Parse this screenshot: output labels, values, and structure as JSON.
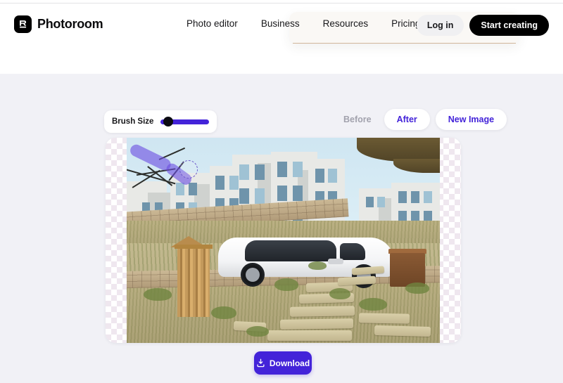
{
  "header": {
    "brand": {
      "name": "Photoroom",
      "logo_icon": "photoroom-logo-icon"
    },
    "nav": [
      {
        "label": "Photo editor"
      },
      {
        "label": "Business"
      },
      {
        "label": "Resources"
      },
      {
        "label": "Pricing"
      }
    ],
    "login_label": "Log in",
    "start_label": "Start creating"
  },
  "editor": {
    "brush": {
      "label": "Brush Size",
      "value": 12,
      "min": 0,
      "max": 100,
      "track_color": "#4323d9",
      "thumb_color": "#0b0b12"
    },
    "view_toggle": {
      "before_label": "Before",
      "after_label": "After",
      "new_image_label": "New Image",
      "selected": "After",
      "active_color": "#4323d9",
      "inactive_color": "#a2a2ad"
    },
    "canvas": {
      "alt": "Photo of a white SUV parked on a terraced hillside with stone walls, stone steps, dry grass and white apartment buildings in the background",
      "transparency_checker": true,
      "brush_stroke_color": "#6c4fe0",
      "cursor_icon": "brush-cursor-ring"
    },
    "download": {
      "label": "Download",
      "icon": "download-icon",
      "color": "#4323d9"
    }
  },
  "theme": {
    "page_bg": "#ffffff",
    "editor_bg": "#f1f1f6",
    "accent": "#4323d9",
    "panel_bg": "#faf8f5",
    "panel_rule": "#c9a98a"
  }
}
